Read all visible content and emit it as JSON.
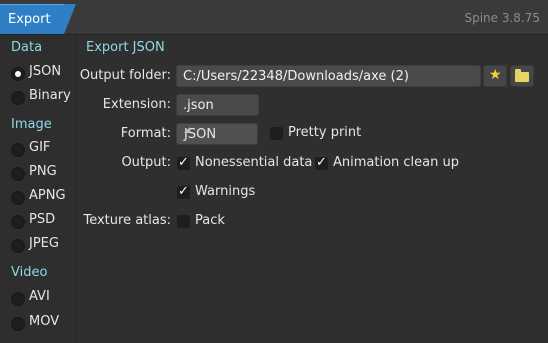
{
  "window": {
    "tab_label": "Export",
    "version": "Spine 3.8.75"
  },
  "sidebar": {
    "sections": [
      {
        "title": "Data",
        "items": [
          {
            "label": "JSON",
            "selected": true
          },
          {
            "label": "Binary",
            "selected": false
          }
        ]
      },
      {
        "title": "Image",
        "items": [
          {
            "label": "GIF"
          },
          {
            "label": "PNG"
          },
          {
            "label": "APNG"
          },
          {
            "label": "PSD"
          },
          {
            "label": "JPEG"
          }
        ]
      },
      {
        "title": "Video",
        "items": [
          {
            "label": "AVI"
          },
          {
            "label": "MOV"
          }
        ]
      }
    ]
  },
  "main": {
    "title": "Export JSON",
    "output_folder": {
      "label": "Output folder:",
      "value": "C:/Users/22348/Downloads/axe (2)",
      "favorite_icon": "star-icon",
      "browse_icon": "folder-icon"
    },
    "extension": {
      "label": "Extension:",
      "value": ".json"
    },
    "format": {
      "label": "Format:",
      "value": "JSON",
      "pretty_print": {
        "label": "Pretty print",
        "checked": false
      }
    },
    "output": {
      "label": "Output:",
      "nonessential": {
        "label": "Nonessential data",
        "checked": true
      },
      "animation_cleanup": {
        "label": "Animation clean up",
        "checked": true
      },
      "warnings": {
        "label": "Warnings",
        "checked": true
      }
    },
    "texture_atlas": {
      "label": "Texture atlas:",
      "pack": {
        "label": "Pack",
        "checked": false
      }
    }
  },
  "colors": {
    "accent": "#2f7fc6",
    "section_title": "#8fd8e6",
    "background": "#2f2f2f"
  }
}
